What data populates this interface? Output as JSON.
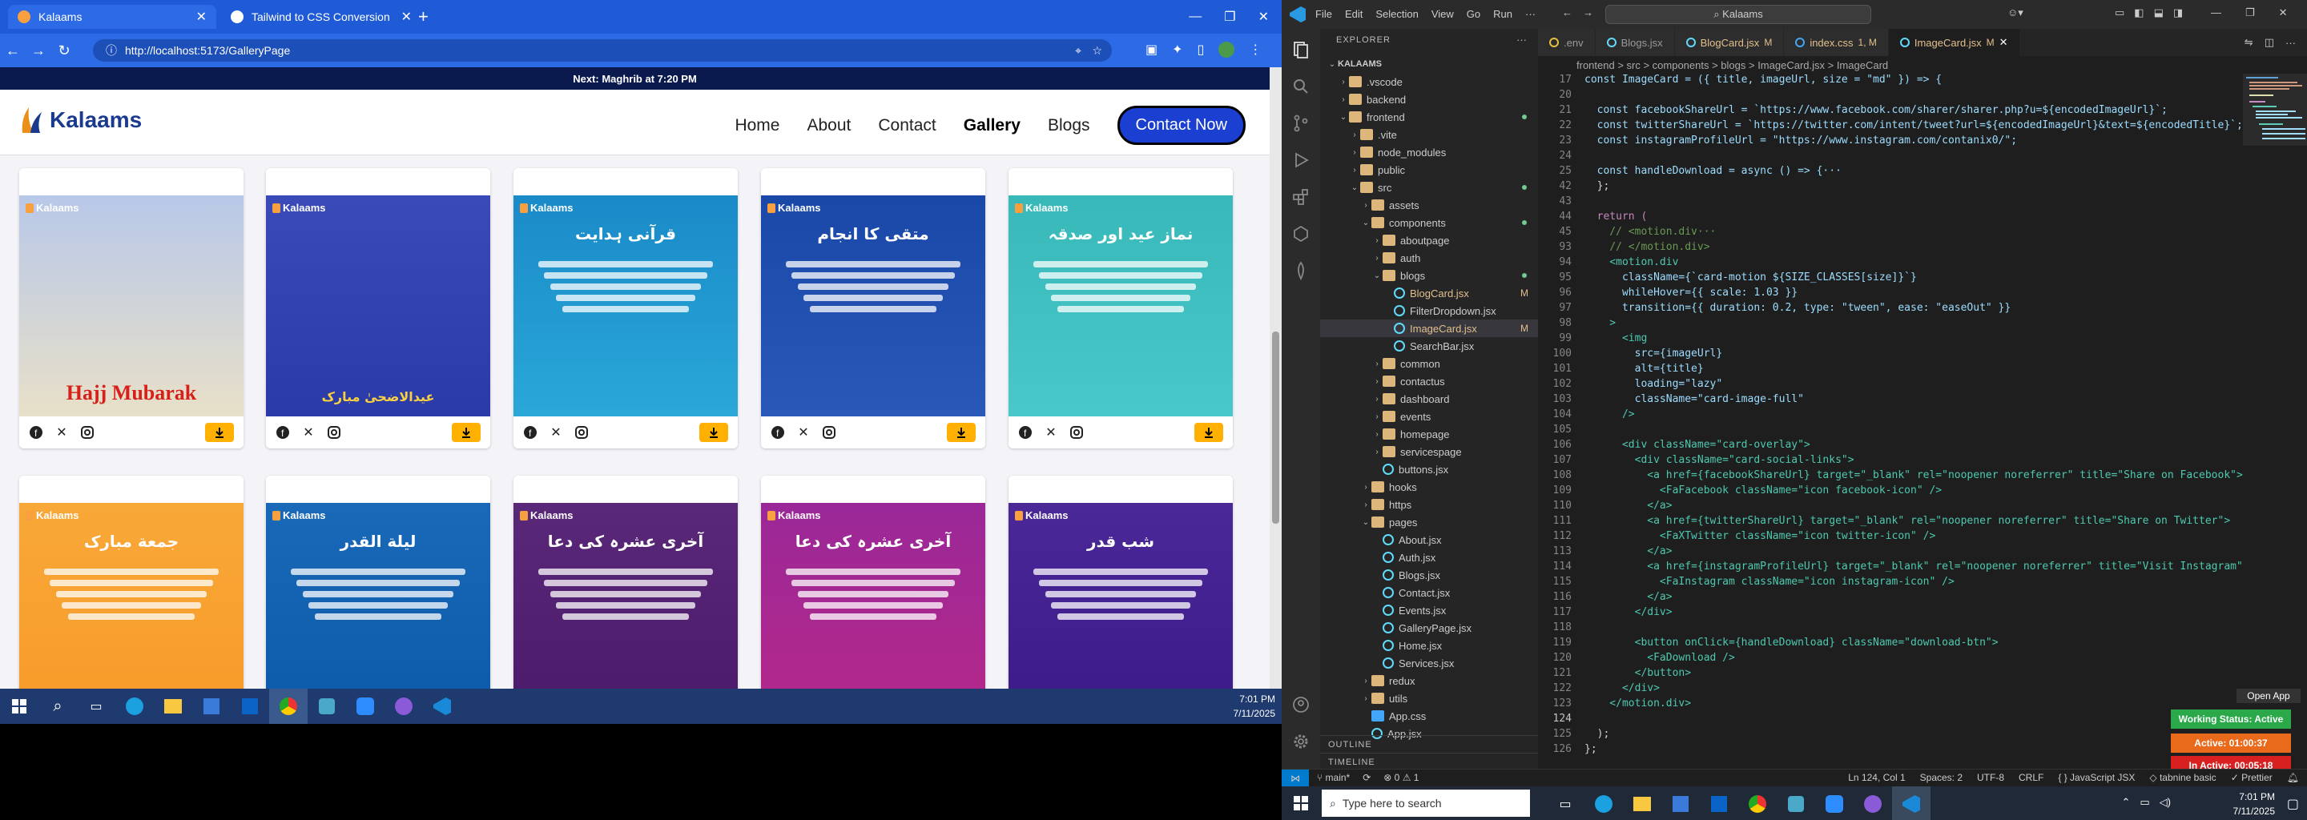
{
  "browser": {
    "tabs": [
      {
        "label": "Kalaams",
        "active": true
      },
      {
        "label": "Tailwind to CSS Conversion",
        "active": false
      }
    ],
    "url": "http://localhost:5173/GalleryPage"
  },
  "site": {
    "announcement": "Next: Maghrib at 7:20 PM",
    "logo": "Kalaams",
    "nav": [
      "Home",
      "About",
      "Contact",
      "Gallery",
      "Blogs"
    ],
    "nav_active": "Gallery",
    "contact_label": "Contact Now",
    "card_brand": "Kalaams",
    "cards": [
      {
        "title": "Hajj Mubarak",
        "color": "#e8e0c8",
        "top": "#b8c8e8"
      },
      {
        "title": "عیدالاضحیٰ مبارک",
        "color": "#2a3aa8",
        "top": "#3a4ab8"
      },
      {
        "title": "قرآنی ہدایت",
        "color": "#2aa8d8",
        "top": "#1a8ac8"
      },
      {
        "title": "متقی کا انجام",
        "color": "#2a58b8",
        "top": "#1a48a8"
      },
      {
        "title": "نماز عید اور صدقہ",
        "color": "#48c8c8",
        "top": "#38b8b8"
      },
      {
        "title": "جمعة مبارک",
        "color": "#f89828",
        "top": "#f8a838"
      },
      {
        "title": "لیلة القدر",
        "color": "#0a58a8",
        "top": "#1a68b8"
      },
      {
        "title": "آخری عشرہ کی دعا",
        "color": "#4a1868",
        "top": "#5a2878"
      },
      {
        "title": "آخری عشرہ کی دعا",
        "color": "#b82888",
        "top": "#9a2898"
      },
      {
        "title": "شب قدر",
        "color": "#3a1888",
        "top": "#4a2898"
      }
    ]
  },
  "taskbar_left": {
    "time": "7:01 PM",
    "date": "7/11/2025"
  },
  "vscode": {
    "menu": [
      "File",
      "Edit",
      "Selection",
      "View",
      "Go",
      "Run"
    ],
    "search": "Kalaams",
    "explorer_title": "EXPLORER",
    "tree": [
      {
        "label": "KALAAMS",
        "depth": 0,
        "type": "root"
      },
      {
        "label": ".vscode",
        "depth": 1,
        "type": "folder"
      },
      {
        "label": "backend",
        "depth": 1,
        "type": "folder"
      },
      {
        "label": "frontend",
        "depth": 1,
        "type": "folder-open",
        "dot": true
      },
      {
        "label": ".vite",
        "depth": 2,
        "type": "folder"
      },
      {
        "label": "node_modules",
        "depth": 2,
        "type": "folder"
      },
      {
        "label": "public",
        "depth": 2,
        "type": "folder"
      },
      {
        "label": "src",
        "depth": 2,
        "type": "folder-open",
        "dot": true
      },
      {
        "label": "assets",
        "depth": 3,
        "type": "folder"
      },
      {
        "label": "components",
        "depth": 3,
        "type": "folder-open",
        "dot": true
      },
      {
        "label": "aboutpage",
        "depth": 4,
        "type": "folder"
      },
      {
        "label": "auth",
        "depth": 4,
        "type": "folder"
      },
      {
        "label": "blogs",
        "depth": 4,
        "type": "folder-open",
        "dot": true
      },
      {
        "label": "BlogCard.jsx",
        "depth": 5,
        "type": "jsx",
        "mark": "M"
      },
      {
        "label": "FilterDropdown.jsx",
        "depth": 5,
        "type": "jsx"
      },
      {
        "label": "ImageCard.jsx",
        "depth": 5,
        "type": "jsx",
        "mark": "M",
        "sel": true
      },
      {
        "label": "SearchBar.jsx",
        "depth": 5,
        "type": "jsx"
      },
      {
        "label": "common",
        "depth": 4,
        "type": "folder"
      },
      {
        "label": "contactus",
        "depth": 4,
        "type": "folder"
      },
      {
        "label": "dashboard",
        "depth": 4,
        "type": "folder"
      },
      {
        "label": "events",
        "depth": 4,
        "type": "folder"
      },
      {
        "label": "homepage",
        "depth": 4,
        "type": "folder"
      },
      {
        "label": "servicespage",
        "depth": 4,
        "type": "folder"
      },
      {
        "label": "buttons.jsx",
        "depth": 4,
        "type": "jsx"
      },
      {
        "label": "hooks",
        "depth": 3,
        "type": "folder"
      },
      {
        "label": "https",
        "depth": 3,
        "type": "folder"
      },
      {
        "label": "pages",
        "depth": 3,
        "type": "folder-open"
      },
      {
        "label": "About.jsx",
        "depth": 4,
        "type": "jsx"
      },
      {
        "label": "Auth.jsx",
        "depth": 4,
        "type": "jsx"
      },
      {
        "label": "Blogs.jsx",
        "depth": 4,
        "type": "jsx"
      },
      {
        "label": "Contact.jsx",
        "depth": 4,
        "type": "jsx"
      },
      {
        "label": "Events.jsx",
        "depth": 4,
        "type": "jsx"
      },
      {
        "label": "GalleryPage.jsx",
        "depth": 4,
        "type": "jsx"
      },
      {
        "label": "Home.jsx",
        "depth": 4,
        "type": "jsx"
      },
      {
        "label": "Services.jsx",
        "depth": 4,
        "type": "jsx"
      },
      {
        "label": "redux",
        "depth": 3,
        "type": "folder"
      },
      {
        "label": "utils",
        "depth": 3,
        "type": "folder"
      },
      {
        "label": "App.css",
        "depth": 3,
        "type": "css"
      },
      {
        "label": "App.jsx",
        "depth": 3,
        "type": "jsx"
      }
    ],
    "outline": "OUTLINE",
    "timeline": "TIMELINE",
    "editor_tabs": [
      {
        "label": ".env",
        "mod": ""
      },
      {
        "label": "Blogs.jsx",
        "mod": ""
      },
      {
        "label": "BlogCard.jsx",
        "mod": "M"
      },
      {
        "label": "index.css",
        "mod": "1, M"
      },
      {
        "label": "ImageCard.jsx",
        "mod": "M",
        "active": true
      }
    ],
    "breadcrumb": "frontend > src > components > blogs > ImageCard.jsx > ImageCard",
    "code": [
      {
        "n": "17",
        "t": "const ImageCard = ({ title, imageUrl, size = \"md\" }) => {"
      },
      {
        "n": "20",
        "t": ""
      },
      {
        "n": "21",
        "t": "  const facebookShareUrl = `https://www.facebook.com/sharer/sharer.php?u=${encodedImageUrl}`;"
      },
      {
        "n": "22",
        "t": "  const twitterShareUrl = `https://twitter.com/intent/tweet?url=${encodedImageUrl}&text=${encodedTitle}`;"
      },
      {
        "n": "23",
        "t": "  const instagramProfileUrl = \"https://www.instagram.com/contanix0/\";"
      },
      {
        "n": "24",
        "t": ""
      },
      {
        "n": "25",
        "t": "  const handleDownload = async () => {···"
      },
      {
        "n": "42",
        "t": "  };"
      },
      {
        "n": "43",
        "t": ""
      },
      {
        "n": "44",
        "t": "  return ("
      },
      {
        "n": "45",
        "t": "    // <motion.div···"
      },
      {
        "n": "93",
        "t": "    // </motion.div>"
      },
      {
        "n": "94",
        "t": "    <motion.div"
      },
      {
        "n": "95",
        "t": "      className={`card-motion ${SIZE_CLASSES[size]}`}"
      },
      {
        "n": "96",
        "t": "      whileHover={{ scale: 1.03 }}"
      },
      {
        "n": "97",
        "t": "      transition={{ duration: 0.2, type: \"tween\", ease: \"easeOut\" }}"
      },
      {
        "n": "98",
        "t": "    >"
      },
      {
        "n": "99",
        "t": "      <img"
      },
      {
        "n": "100",
        "t": "        src={imageUrl}"
      },
      {
        "n": "101",
        "t": "        alt={title}"
      },
      {
        "n": "102",
        "t": "        loading=\"lazy\""
      },
      {
        "n": "103",
        "t": "        className=\"card-image-full\""
      },
      {
        "n": "104",
        "t": "      />"
      },
      {
        "n": "105",
        "t": ""
      },
      {
        "n": "106",
        "t": "      <div className=\"card-overlay\">"
      },
      {
        "n": "107",
        "t": "        <div className=\"card-social-links\">"
      },
      {
        "n": "108",
        "t": "          <a href={facebookShareUrl} target=\"_blank\" rel=\"noopener noreferrer\" title=\"Share on Facebook\">"
      },
      {
        "n": "109",
        "t": "            <FaFacebook className=\"icon facebook-icon\" />"
      },
      {
        "n": "110",
        "t": "          </a>"
      },
      {
        "n": "111",
        "t": "          <a href={twitterShareUrl} target=\"_blank\" rel=\"noopener noreferrer\" title=\"Share on Twitter\">"
      },
      {
        "n": "112",
        "t": "            <FaXTwitter className=\"icon twitter-icon\" />"
      },
      {
        "n": "113",
        "t": "          </a>"
      },
      {
        "n": "114",
        "t": "          <a href={instagramProfileUrl} target=\"_blank\" rel=\"noopener noreferrer\" title=\"Visit Instagram\">"
      },
      {
        "n": "115",
        "t": "            <FaInstagram className=\"icon instagram-icon\" />"
      },
      {
        "n": "116",
        "t": "          </a>"
      },
      {
        "n": "117",
        "t": "        </div>"
      },
      {
        "n": "118",
        "t": ""
      },
      {
        "n": "119",
        "t": "        <button onClick={handleDownload} className=\"download-btn\">"
      },
      {
        "n": "120",
        "t": "          <FaDownload />"
      },
      {
        "n": "121",
        "t": "        </button>"
      },
      {
        "n": "122",
        "t": "      </div>"
      },
      {
        "n": "123",
        "t": "    </motion.div>"
      },
      {
        "n": "124",
        "t": ""
      },
      {
        "n": "125",
        "t": "  );"
      },
      {
        "n": "126",
        "t": "};"
      }
    ],
    "status": {
      "branch": "main*",
      "problems": "⊗ 0 ⚠ 1",
      "position": "Ln 124, Col 1",
      "spaces": "Spaces: 2",
      "encoding": "UTF-8",
      "eol": "CRLF",
      "language": "{ } JavaScript JSX",
      "tabnine": "tabnine basic",
      "prettier": "Prettier"
    },
    "badges": {
      "open_app": "Open App",
      "working": "Working Status: Active",
      "active": "Active: 01:00:37",
      "inactive": "In Active: 00:05:18"
    }
  },
  "taskbar_right": {
    "search_placeholder": "Type here to search",
    "time": "7:01 PM",
    "date": "7/11/2025"
  }
}
